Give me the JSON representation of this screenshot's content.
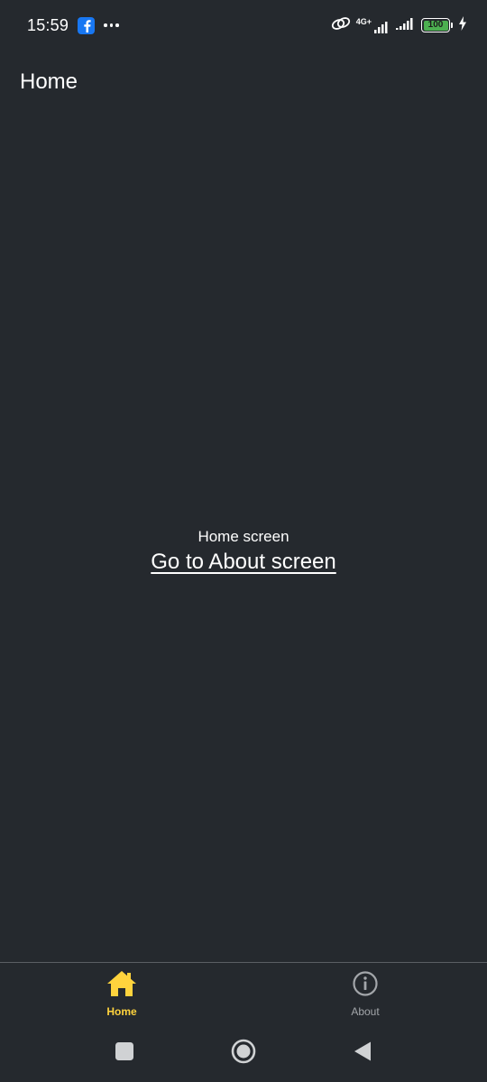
{
  "status_bar": {
    "time": "15:59",
    "network_label": "4G+",
    "battery_level": "100"
  },
  "header": {
    "title": "Home"
  },
  "main": {
    "screen_label": "Home screen",
    "link_text": "Go to About screen"
  },
  "tabs": [
    {
      "label": "Home",
      "icon": "home-icon",
      "active": true
    },
    {
      "label": "About",
      "icon": "info-icon",
      "active": false
    }
  ],
  "colors": {
    "background": "#25292e",
    "accent": "#ffd33d",
    "inactive": "#a3a6aa",
    "battery": "#4caf50",
    "facebook": "#1877f2"
  }
}
